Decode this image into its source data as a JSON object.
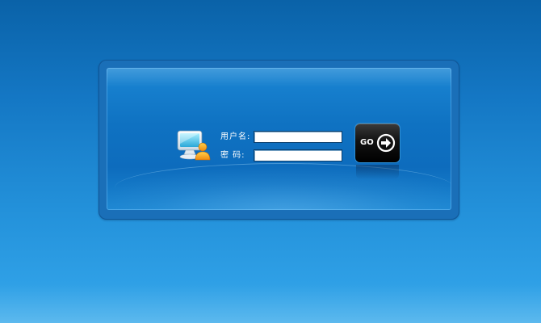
{
  "login": {
    "username_label": "用户名:",
    "password_label": "密  码:",
    "username_value": "",
    "password_value": "",
    "submit_label": "GO"
  },
  "icons": {
    "user": "computer-user-icon",
    "submit_arrow": "arrow-right-circle-icon"
  },
  "colors": {
    "background": "#1477c4",
    "panel": "#0f72c2",
    "button": "#000000"
  }
}
